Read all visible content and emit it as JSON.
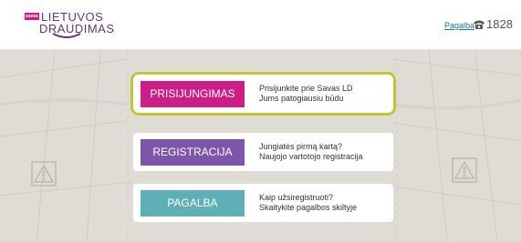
{
  "header": {
    "logo": {
      "badge": "savas",
      "line1": "LIETUVOS",
      "line2": "DRAUDIMAS"
    },
    "help_link": "Pagalba",
    "phone_number": "1828",
    "phone_icon": "phone-icon"
  },
  "cards": {
    "login": {
      "button_label": "PRISIJUNGIMAS",
      "button_color": "#cc1e86",
      "line1": "Prisijunkite prie Savas LD",
      "line2": "Jums patogiausiu būdu"
    },
    "register": {
      "button_label": "REGISTRACIJA",
      "button_color": "#7d55ab",
      "line1": "Jungiatės pirmą kartą?",
      "line2": "Naujojo vartotojo registracija"
    },
    "help": {
      "button_label": "PAGALBA",
      "button_color": "#5fb0b6",
      "line1": "Kaip užsiregistruoti?",
      "line2": "Skaitykite pagalbos skiltyje"
    }
  },
  "colors": {
    "highlight": "#c4c436",
    "background": "#dfdcd5",
    "brand_purple": "#5b3b76",
    "brand_pink": "#d01f7a"
  }
}
